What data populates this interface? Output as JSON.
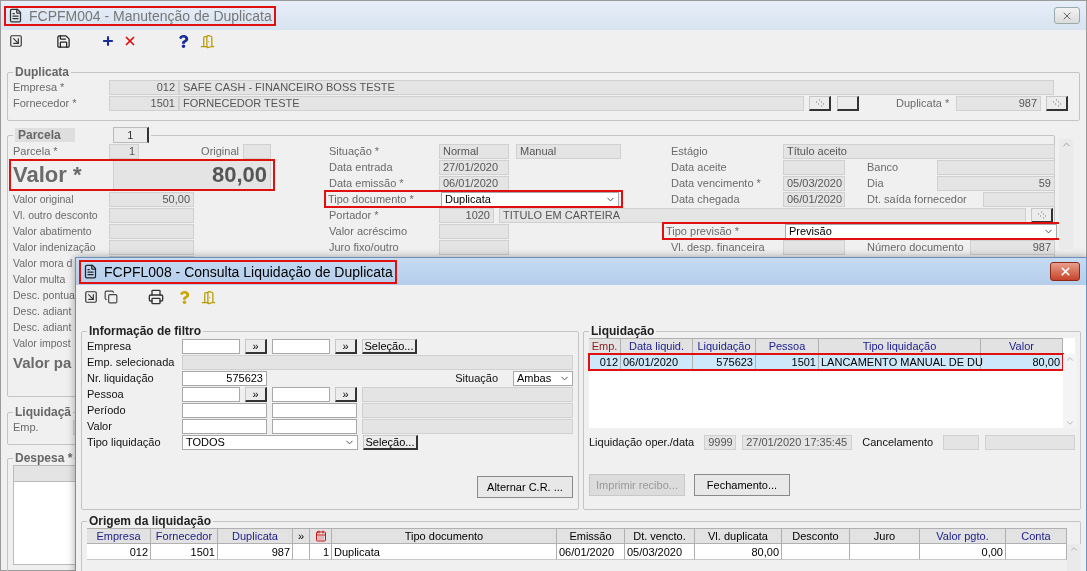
{
  "main_window": {
    "title": "FCPFM004 - Manutenção de Duplicata",
    "highlighted": true
  },
  "duplicata": {
    "legend": "Duplicata",
    "empresa": {
      "label": "Empresa *",
      "code": "012",
      "name": "SAFE CASH - FINANCEIRO BOSS TESTE"
    },
    "fornecedor": {
      "label": "Fornecedor *",
      "code": "1501",
      "name": "FORNECEDOR TESTE"
    },
    "duplicata": {
      "label": "Duplicata *",
      "value": "987"
    }
  },
  "parcela": {
    "legend": "Parcela",
    "tab": "1",
    "parcela": {
      "label": "Parcela *",
      "value": "1"
    },
    "original": {
      "label": "Original"
    },
    "valor": {
      "label": "Valor *",
      "value": "80,00",
      "highlighted": true
    },
    "left_fields": [
      {
        "label": "Valor original",
        "value": "50,00"
      },
      {
        "label": "Vl. outro desconto"
      },
      {
        "label": "Valor abatimento"
      },
      {
        "label": "Valor indenização"
      },
      {
        "label": "Valor mora d"
      },
      {
        "label": "Valor multa"
      },
      {
        "label": "Desc. pontua"
      },
      {
        "label": "Desc. adiant"
      },
      {
        "label": "Desc. adiant"
      },
      {
        "label": "Valor impost"
      }
    ],
    "valor_pago": {
      "label": "Valor pa"
    },
    "situacao": {
      "label": "Situação *",
      "value": "Normal",
      "origin": "Manual"
    },
    "data_entrada": {
      "label": "Data entrada",
      "value": "27/01/2020"
    },
    "data_emissao": {
      "label": "Data emissão *",
      "value": "06/01/2020"
    },
    "tipo_documento": {
      "label": "Tipo documento *",
      "value": "Duplicata",
      "highlighted": true
    },
    "portador": {
      "label": "Portador *",
      "code": "1020",
      "name": "TITULO EM CARTEIRA"
    },
    "valor_acrescimo": {
      "label": "Valor acréscimo"
    },
    "juro": {
      "label": "Juro fixo/outro"
    },
    "estagio": {
      "label": "Estágio",
      "value": "Título aceito"
    },
    "data_aceite": {
      "label": "Data aceite"
    },
    "banco": {
      "label": "Banco"
    },
    "data_vencimento": {
      "label": "Data vencimento *",
      "value": "05/03/2020"
    },
    "dia": {
      "label": "Dia",
      "value": "59"
    },
    "data_chegada": {
      "label": "Data chegada",
      "value": "06/01/2020"
    },
    "dt_saida": {
      "label": "Dt. saída fornecedor"
    },
    "tipo_previsao": {
      "label": "Tipo previsão *",
      "value": "Previsão",
      "highlighted": true
    },
    "vl_desp": {
      "label": "Vl. desp. financeira"
    },
    "numero_documento": {
      "label": "Número documento",
      "value": "987"
    }
  },
  "liquidacao": {
    "legend": "Liquidaçã",
    "emp_label": "Emp."
  },
  "despesa": {
    "legend": "Despesa *"
  },
  "dialog": {
    "title": "FCPFL008 - Consulta Liquidação de Duplicata",
    "highlighted": true,
    "filter": {
      "legend": "Informação de filtro",
      "empresa": {
        "label": "Empresa",
        "more": [
          "»",
          "»"
        ],
        "button": "Seleção..."
      },
      "emp_selecionada": {
        "label": "Emp. selecionada"
      },
      "nr_liquidacao": {
        "label": "Nr. liquidação",
        "value": "575623"
      },
      "situacao": {
        "label": "Situação",
        "value": "Ambas"
      },
      "pessoa": {
        "label": "Pessoa",
        "more": [
          "»",
          "»"
        ]
      },
      "periodo": {
        "label": "Período"
      },
      "valor": {
        "label": "Valor"
      },
      "tipo_liquidacao": {
        "label": "Tipo liquidação",
        "value": "TODOS",
        "button": "Seleção..."
      },
      "alternar_button": "Alternar C.R. ..."
    },
    "liquidacao": {
      "legend": "Liquidação",
      "columns": [
        {
          "label": "Emp.",
          "color": "#8b1c1c"
        },
        {
          "label": "Data liquid.",
          "color": "#1c1c8c"
        },
        {
          "label": "Liquidação",
          "color": "#1c1c8c"
        },
        {
          "label": "Pessoa",
          "color": "#1c1c8c"
        },
        {
          "label": "Tipo liquidação",
          "color": "#1c1c8c"
        },
        {
          "label": "Valor",
          "color": "#1c1c8c"
        }
      ],
      "rows": [
        {
          "cells": [
            "012",
            "06/01/2020",
            "575623",
            "1501",
            "LANCAMENTO MANUAL DE DU",
            "80,00"
          ],
          "selected": true,
          "highlighted": true
        }
      ],
      "oper_label": "Liquidação oper./data",
      "oper_code": "9999",
      "oper_date": "27/01/2020 17:35:45",
      "cancel_label": "Cancelamento",
      "buttons": [
        {
          "label": "Imprimir recibo...",
          "disabled": true
        },
        {
          "label": "Fechamento...",
          "disabled": false
        }
      ]
    },
    "origem": {
      "legend": "Origem da liquidação",
      "columns": [
        {
          "kind": "text",
          "label": "Empresa",
          "linked": true
        },
        {
          "kind": "text",
          "label": "Fornecedor",
          "linked": true
        },
        {
          "kind": "text",
          "label": "Duplicata",
          "linked": true
        },
        {
          "kind": "text",
          "label": "»",
          "linked": false
        },
        {
          "kind": "icon"
        },
        {
          "kind": "text",
          "label": "Tipo documento",
          "linked": false
        },
        {
          "kind": "text",
          "label": "Emissão",
          "linked": false
        },
        {
          "kind": "text",
          "label": "Dt. vencto.",
          "linked": false
        },
        {
          "kind": "text",
          "label": "Vl. duplicata",
          "linked": false
        },
        {
          "kind": "text",
          "label": "Desconto",
          "linked": false
        },
        {
          "kind": "text",
          "label": "Juro",
          "linked": false
        },
        {
          "kind": "text",
          "label": "Valor  pgto.",
          "linked": true
        },
        {
          "kind": "text",
          "label": "Conta",
          "linked": true
        }
      ],
      "rows": [
        {
          "cells": [
            "012",
            "1501",
            "987",
            null,
            "1",
            "Duplicata",
            "06/01/2020",
            "05/03/2020",
            "80,00",
            null,
            null,
            "0,00",
            null
          ]
        }
      ]
    }
  }
}
